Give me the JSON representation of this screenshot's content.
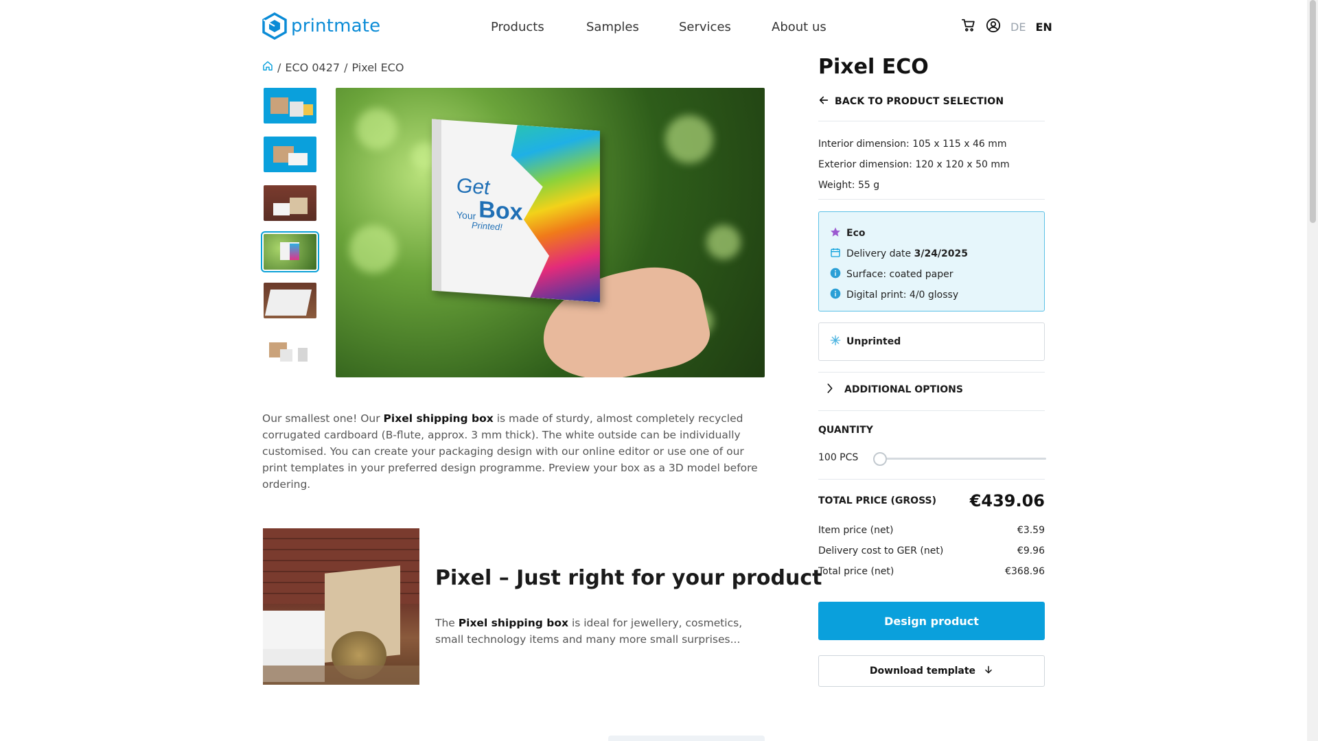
{
  "brand": {
    "name": "printmate",
    "accent": "#0aa0dc"
  },
  "nav": {
    "items": [
      "Products",
      "Samples",
      "Services",
      "About us"
    ]
  },
  "header": {
    "cart_icon": "cart-icon",
    "account_icon": "user-icon",
    "languages": [
      "DE",
      "EN"
    ],
    "active_language": "EN"
  },
  "breadcrumb": {
    "home_icon": "home-icon",
    "items": [
      "ECO 0427",
      "Pixel ECO"
    ]
  },
  "gallery": {
    "active_index": 3,
    "main_image_text": {
      "line1": "Get",
      "line2": "Your",
      "line3": "Box",
      "line4": "Printed!"
    }
  },
  "description": {
    "pre": "Our smallest one! Our ",
    "bold": "Pixel shipping box",
    "post": " is made of sturdy, almost completely recycled corrugated cardboard (B-flute, approx. 3 mm thick). The white outside can be individually customised. You can create your packaging design with our online editor or use one of our print templates in your preferred design programme. Preview your box as a 3D model before ordering."
  },
  "feature": {
    "title": "Pixel – Just right for your product",
    "text_pre": "The ",
    "text_bold": "Pixel shipping box",
    "text_post": " is ideal for jewellery, cosmetics, small technology items and many more small surprises..."
  },
  "product": {
    "title": "Pixel ECO",
    "back_label": "BACK TO PRODUCT SELECTION",
    "interior": "Interior dimension: 105 x 115 x 46 mm",
    "exterior": "Exterior dimension: 120 x 120 x 50 mm",
    "weight": "Weight: 55 g"
  },
  "eco": {
    "label": "Eco",
    "delivery_label": "Delivery date ",
    "delivery_date": "3/24/2025",
    "surface": "Surface: coated paper",
    "print": "Digital print: 4/0 glossy"
  },
  "options": {
    "unprinted": "Unprinted",
    "additional": "ADDITIONAL OPTIONS"
  },
  "quantity": {
    "label": "QUANTITY",
    "value": "100 PCS",
    "slider_fraction": 0.0
  },
  "pricing": {
    "total_label": "TOTAL PRICE (GROSS)",
    "total_value": "€439.06",
    "lines": [
      {
        "label": "Item price (net)",
        "value": "€3.59"
      },
      {
        "label": "Delivery cost to GER (net)",
        "value": "€9.96"
      },
      {
        "label": "Total price (net)",
        "value": "€368.96"
      }
    ]
  },
  "actions": {
    "design": "Design product",
    "download": "Download template"
  }
}
